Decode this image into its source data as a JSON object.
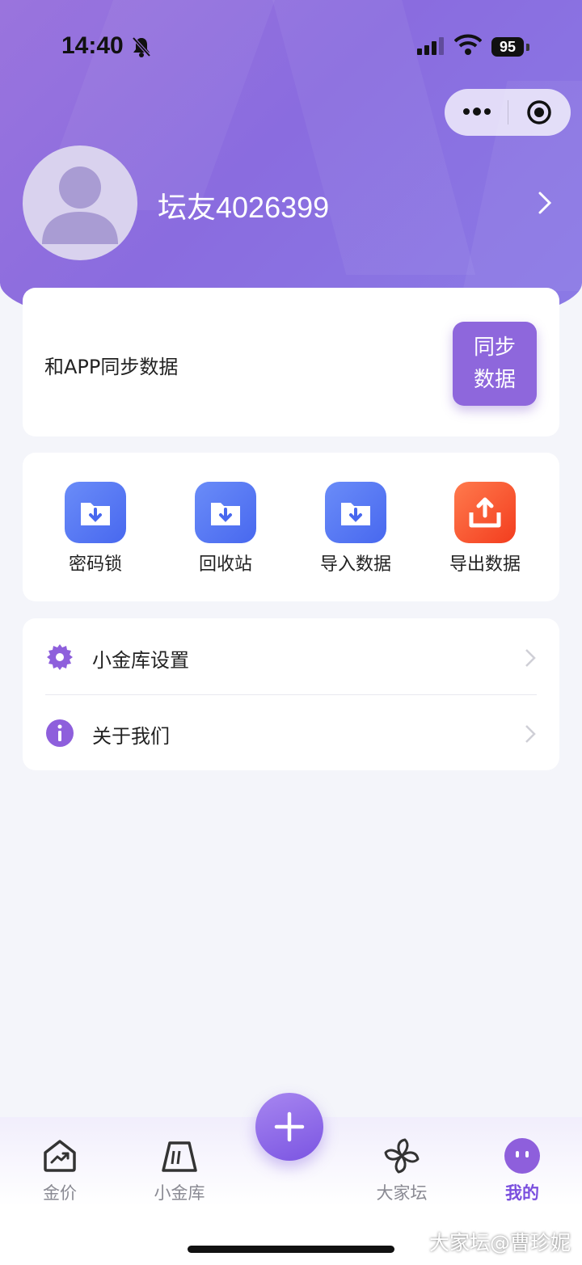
{
  "status_bar": {
    "time": "14:40",
    "battery": "95"
  },
  "profile": {
    "username": "坛友4026399"
  },
  "sync": {
    "text": "和APP同步数据",
    "button_line1": "同步",
    "button_line2": "数据"
  },
  "actions": [
    {
      "label": "密码锁",
      "icon": "folder-download-icon"
    },
    {
      "label": "回收站",
      "icon": "folder-download-icon"
    },
    {
      "label": "导入数据",
      "icon": "folder-download-icon"
    },
    {
      "label": "导出数据",
      "icon": "upload-tray-icon"
    }
  ],
  "menu": [
    {
      "label": "小金库设置",
      "icon": "gear-icon"
    },
    {
      "label": "关于我们",
      "icon": "info-icon"
    }
  ],
  "tabs": [
    {
      "label": "金价",
      "icon": "chart-trend-icon"
    },
    {
      "label": "小金库",
      "icon": "vault-icon"
    },
    {
      "label": "大家坛",
      "icon": "pinwheel-icon"
    },
    {
      "label": "我的",
      "icon": "face-icon",
      "active": true
    }
  ],
  "watermark": "大家坛@曹珍妮",
  "colors": {
    "accent": "#8e67dc",
    "active_tab": "#7a4fde",
    "export": "#f33d1e",
    "import": "#4868ef"
  }
}
